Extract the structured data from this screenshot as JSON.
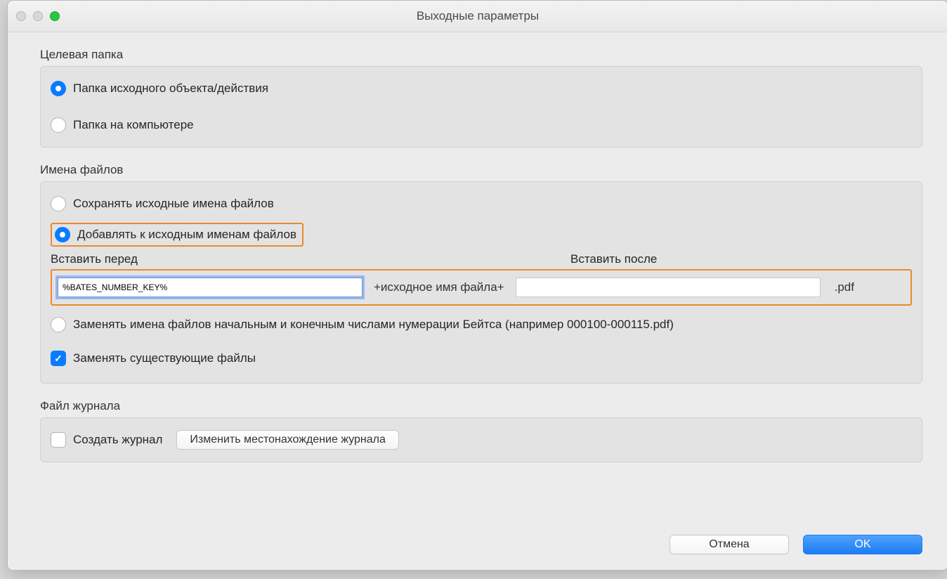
{
  "window": {
    "title": "Выходные параметры"
  },
  "target_folder": {
    "heading": "Целевая папка",
    "opt_source": "Папка исходного объекта/действия",
    "opt_computer": "Папка на компьютере"
  },
  "file_names": {
    "heading": "Имена файлов",
    "opt_keep": "Сохранять исходные имена файлов",
    "opt_append": "Добавлять к исходным именам файлов",
    "label_before": "Вставить перед",
    "label_after": "Вставить после",
    "value_before": "%BATES_NUMBER_KEY%",
    "value_after": "",
    "between": "+исходное имя файла+",
    "ext": ".pdf",
    "opt_bates": "Заменять имена файлов начальным и конечным числами нумерации Бейтса (например 000100-000115.pdf)",
    "chk_overwrite": "Заменять существующие файлы"
  },
  "log": {
    "heading": "Файл журнала",
    "chk_create": "Создать журнал",
    "btn_change_location": "Изменить местонахождение журнала"
  },
  "footer": {
    "cancel": "Отмена",
    "ok": "OK"
  }
}
